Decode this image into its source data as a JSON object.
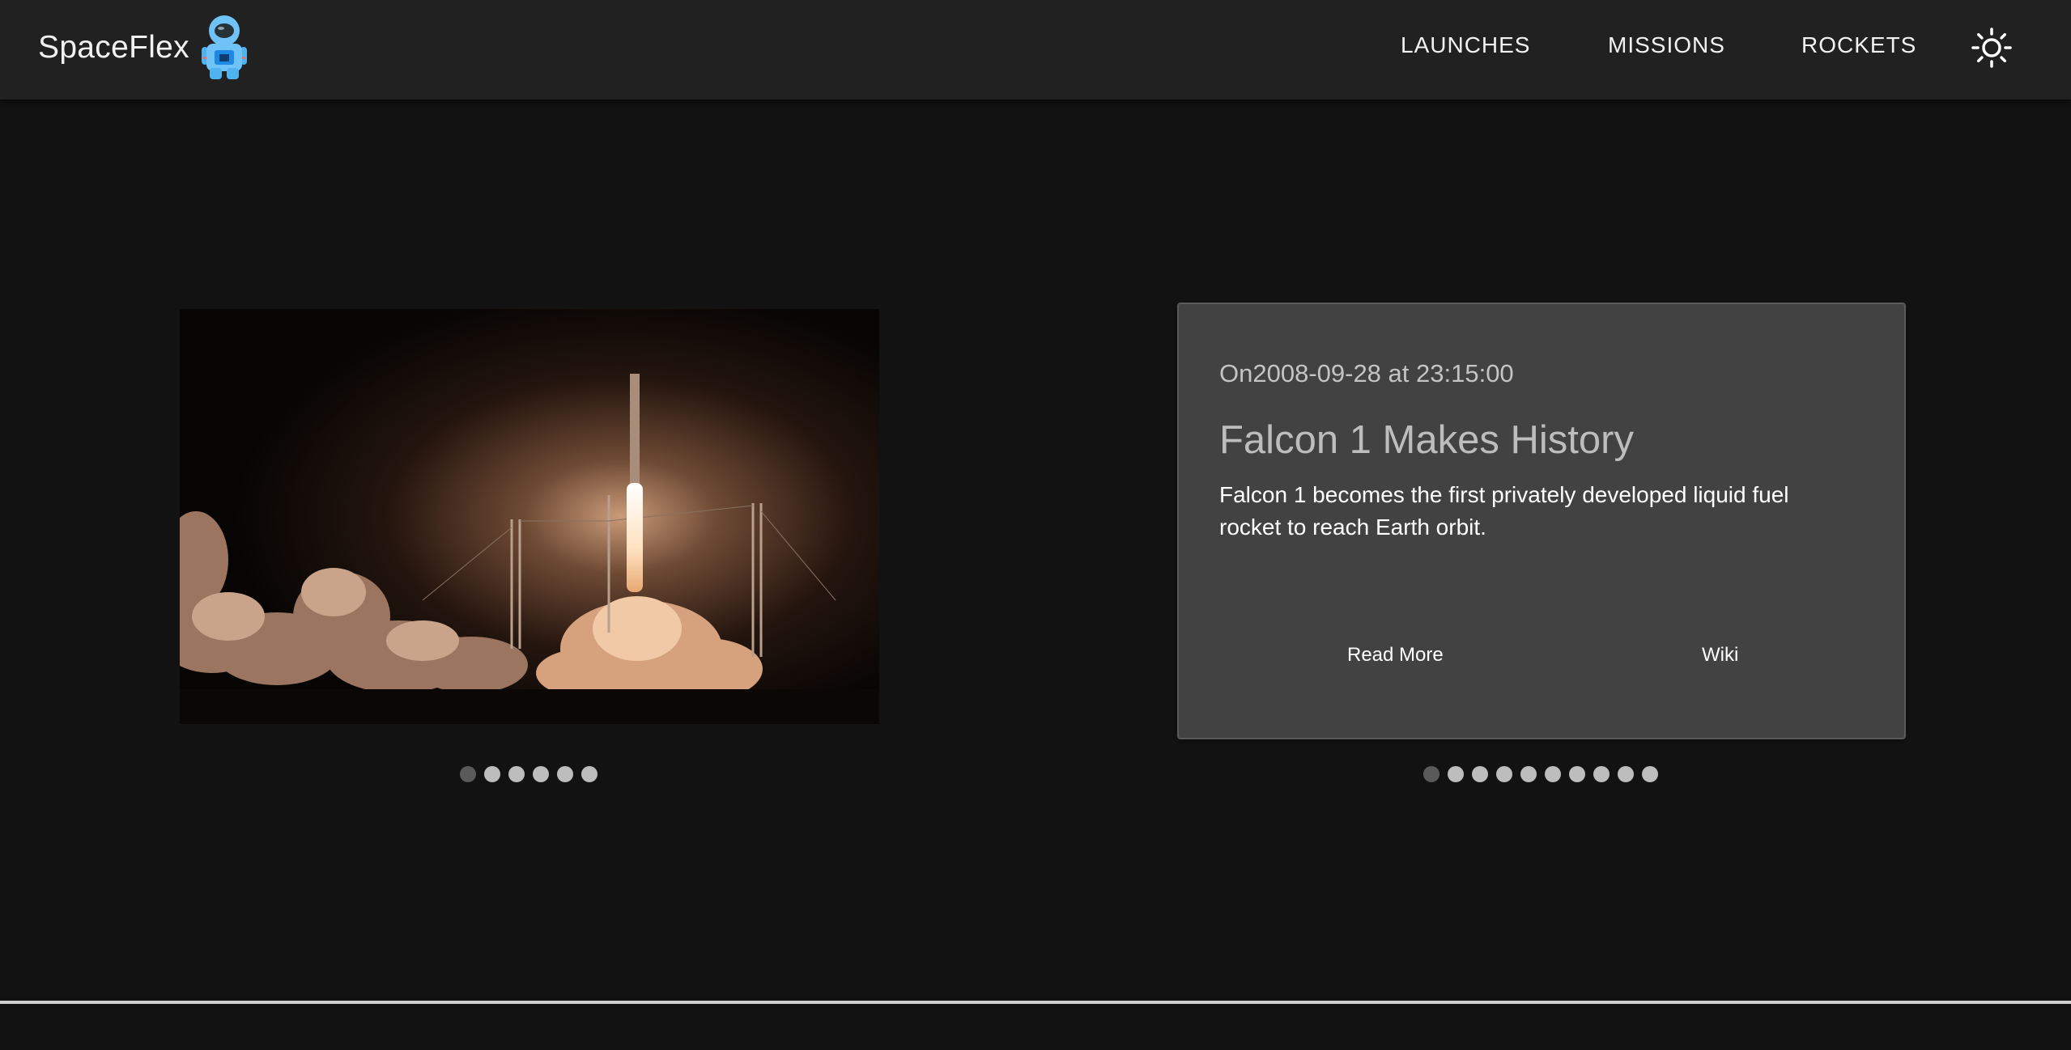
{
  "header": {
    "brand": "SpaceFlex",
    "logo_icon": "astronaut-icon",
    "nav": [
      {
        "label": "LAUNCHES"
      },
      {
        "label": "MISSIONS"
      },
      {
        "label": "ROCKETS"
      }
    ],
    "theme_icon": "sun-icon"
  },
  "gallery": {
    "image_subject": "rocket launch at night",
    "slide_count": 6,
    "active_index": 0
  },
  "history": {
    "date_line": "On2008-09-28 at 23:15:00",
    "title": "Falcon 1 Makes History",
    "description": "Falcon 1 becomes the first privately developed liquid fuel rocket to reach Earth orbit.",
    "read_more_label": "Read More",
    "wiki_label": "Wiki",
    "slide_count": 10,
    "active_index": 0
  },
  "colors": {
    "background": "#121212",
    "appbar": "#212121",
    "card": "#424242",
    "dot_active": "#5a5a5a",
    "dot_inactive": "#bdbdbd"
  }
}
